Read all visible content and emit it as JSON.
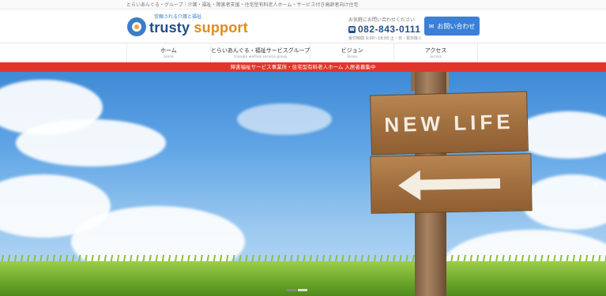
{
  "topbar": {
    "text": "とらいあんぐる・グループ｜介護・福祉・障害者支援・住宅型有料老人ホーム・サービス付き高齢者向け住宅"
  },
  "header": {
    "logo_tagline": "信頼される介護と福祉",
    "logo_name_main": "trusty ",
    "logo_name_accent": "support",
    "contact_lead": "お気軽にお問い合わせください",
    "phone_icon": "☎",
    "phone_number": "082-843-0111",
    "hours": "受付時間 9:00~18:00 土・日・祝日除く",
    "cta_icon": "✉",
    "cta_label": "お問い合わせ"
  },
  "nav": {
    "items": [
      {
        "label": "ホーム",
        "sub": "home"
      },
      {
        "label": "とらいあんぐる・福祉サービスグループ",
        "sub": "triangle welfare service group"
      },
      {
        "label": "ビジョン",
        "sub": "Vision"
      },
      {
        "label": "アクセス",
        "sub": "access"
      }
    ]
  },
  "notice": {
    "text": "障害福祉サービス事業所・住宅型有料老人ホーム 入居者募集中"
  },
  "hero": {
    "sign_top": "NEW LIFE",
    "next_arrow": "›",
    "slides": [
      {
        "active": true
      },
      {
        "active": false
      }
    ]
  },
  "colors": {
    "brand": "#1f4f8b",
    "accent": "#e08a1e",
    "cta": "#3a80d6",
    "notice": "#e1352a"
  }
}
